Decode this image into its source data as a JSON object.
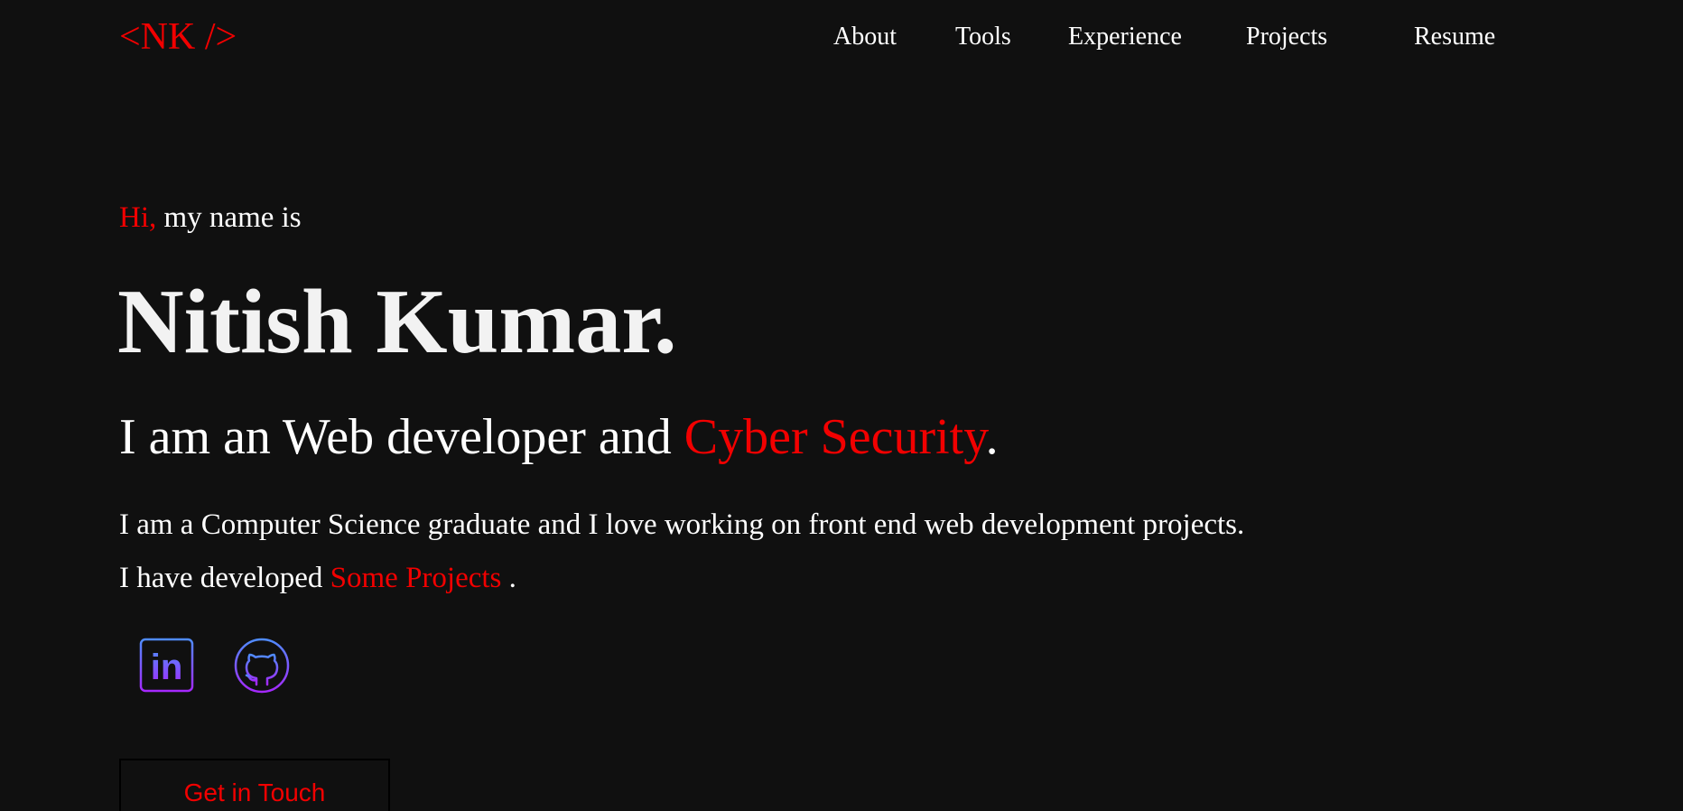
{
  "header": {
    "logo": "<NK />",
    "nav": [
      "About",
      "Tools",
      "Experience",
      "Projects",
      "Resume"
    ]
  },
  "hero": {
    "greeting_accent": "Hi,",
    "greeting_rest": " my name is",
    "name": "Nitish Kumar.",
    "tagline_start": "I am an Web developer and ",
    "tagline_accent": "Cyber Security",
    "tagline_end": ".",
    "paragraph1": "I am a Computer Science graduate and I love working on front end web development projects.",
    "paragraph2_start": "I have developed ",
    "paragraph2_link": "Some Projects",
    "paragraph2_end": " .",
    "cta_label": "Get in Touch"
  },
  "social": [
    {
      "icon": "linkedin-icon",
      "label": "in"
    },
    {
      "icon": "github-icon"
    }
  ],
  "colors": {
    "background": "#101010",
    "accent": "#f20000",
    "text": "#ffffff",
    "icon_gradient_start": "#4f8cff",
    "icon_gradient_end": "#a528ff"
  }
}
